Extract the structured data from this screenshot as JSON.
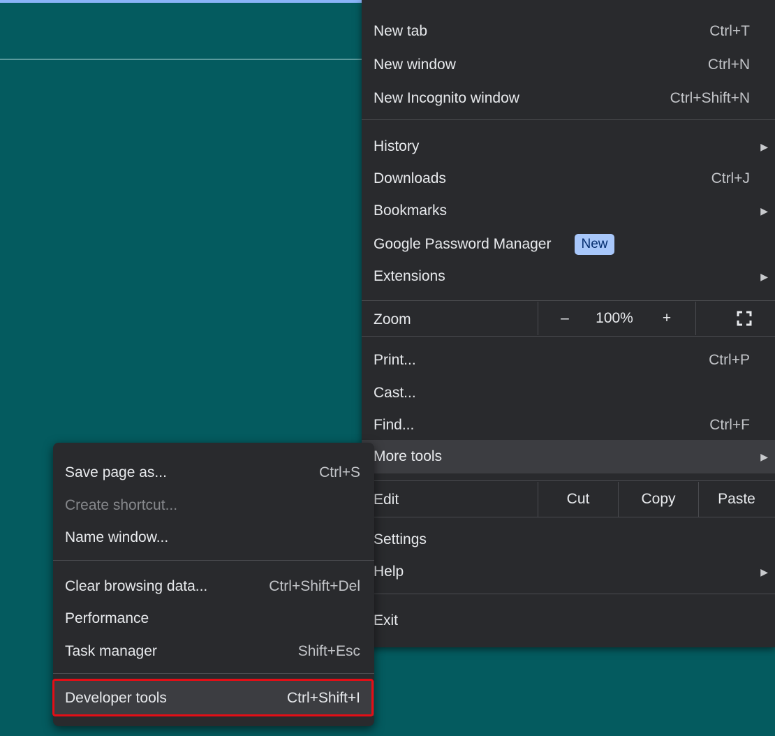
{
  "menu": {
    "new_tab": {
      "label": "New tab",
      "shortcut": "Ctrl+T"
    },
    "new_window": {
      "label": "New window",
      "shortcut": "Ctrl+N"
    },
    "new_incognito": {
      "label": "New Incognito window",
      "shortcut": "Ctrl+Shift+N"
    },
    "history": {
      "label": "History"
    },
    "downloads": {
      "label": "Downloads",
      "shortcut": "Ctrl+J"
    },
    "bookmarks": {
      "label": "Bookmarks"
    },
    "password_manager": {
      "label": "Google Password Manager",
      "badge": "New"
    },
    "extensions": {
      "label": "Extensions"
    },
    "zoom": {
      "label": "Zoom",
      "minus": "–",
      "value": "100%",
      "plus": "+"
    },
    "print": {
      "label": "Print...",
      "shortcut": "Ctrl+P"
    },
    "cast": {
      "label": "Cast..."
    },
    "find": {
      "label": "Find...",
      "shortcut": "Ctrl+F"
    },
    "more_tools": {
      "label": "More tools"
    },
    "edit": {
      "label": "Edit",
      "cut": "Cut",
      "copy": "Copy",
      "paste": "Paste"
    },
    "settings": {
      "label": "Settings"
    },
    "help": {
      "label": "Help"
    },
    "exit": {
      "label": "Exit"
    }
  },
  "submenu": {
    "save_page": {
      "label": "Save page as...",
      "shortcut": "Ctrl+S"
    },
    "create_shortcut": {
      "label": "Create shortcut..."
    },
    "name_window": {
      "label": "Name window..."
    },
    "clear_data": {
      "label": "Clear browsing data...",
      "shortcut": "Ctrl+Shift+Del"
    },
    "performance": {
      "label": "Performance"
    },
    "task_manager": {
      "label": "Task manager",
      "shortcut": "Shift+Esc"
    },
    "developer_tools": {
      "label": "Developer tools",
      "shortcut": "Ctrl+Shift+I"
    }
  },
  "colors": {
    "accent_highlight": "#e30e16",
    "badge": "#a8c7fa",
    "menu_bg": "#292a2d",
    "desktop_bg": "#045b5f"
  }
}
